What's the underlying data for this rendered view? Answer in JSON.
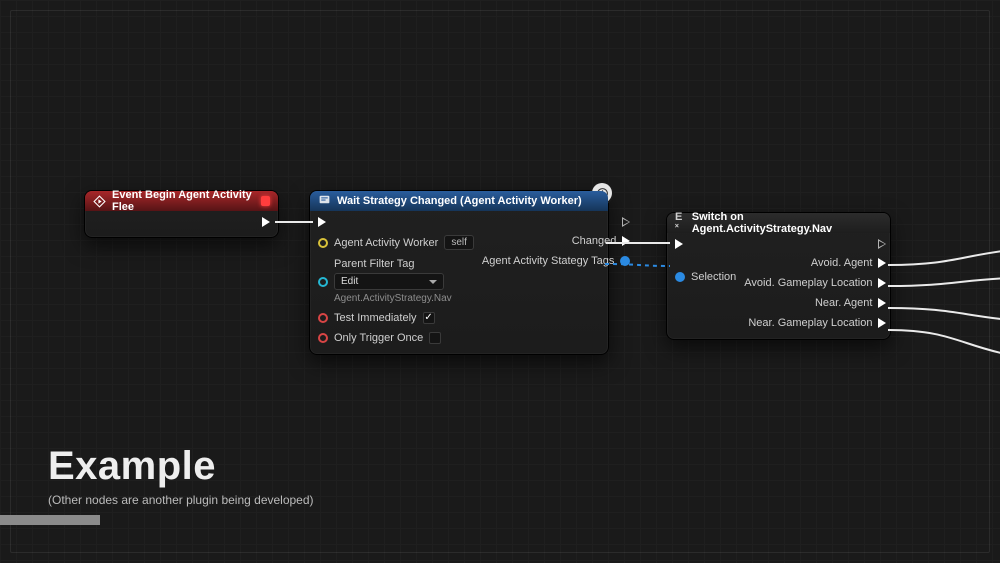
{
  "title": {
    "heading": "Example",
    "subheading": "(Other nodes are another plugin being developed)"
  },
  "node_event": {
    "title": "Event Begin Agent Activity Flee"
  },
  "node_wait": {
    "title": "Wait Strategy Changed (Agent Activity Worker)",
    "in": {
      "agent_worker_label": "Agent Activity Worker",
      "agent_worker_chip": "self",
      "parent_filter_label": "Parent Filter Tag",
      "dropdown_value": "Edit",
      "dropdown_sub": "Agent.ActivityStrategy.Nav",
      "test_immediately_label": "Test Immediately",
      "test_immediately_checked": "✓",
      "only_trigger_once_label": "Only Trigger Once"
    },
    "out": {
      "changed_label": "Changed",
      "tags_label": "Agent Activity Stategy Tags"
    }
  },
  "node_switch": {
    "title": "Switch on Agent.ActivityStrategy.Nav",
    "in": {
      "selection_label": "Selection"
    },
    "out": {
      "o1": "Avoid. Agent",
      "o2": "Avoid. Gameplay Location",
      "o3": "Near. Agent",
      "o4": "Near. Gameplay Location"
    }
  }
}
